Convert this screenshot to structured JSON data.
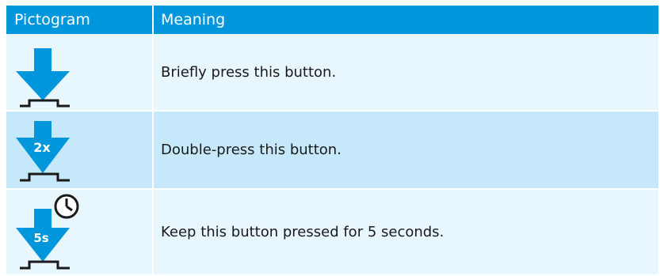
{
  "header": {
    "col_pictogram": "Pictogram",
    "col_meaning": "Meaning"
  },
  "rows": [
    {
      "icon": "press-button-icon",
      "badge": "",
      "meaning": "Briefly press this button."
    },
    {
      "icon": "double-press-button-icon",
      "badge": "2x",
      "meaning": "Double-press this button."
    },
    {
      "icon": "long-press-button-icon",
      "badge": "5s",
      "meaning": "Keep this button pressed for 5 seconds."
    }
  ],
  "colors": {
    "header_bg": "#0096dc",
    "arrow": "#0096dc",
    "row_light": "#e8f6fe",
    "row_dark": "#c6e8fb",
    "button_outline": "#1a1a1a"
  }
}
